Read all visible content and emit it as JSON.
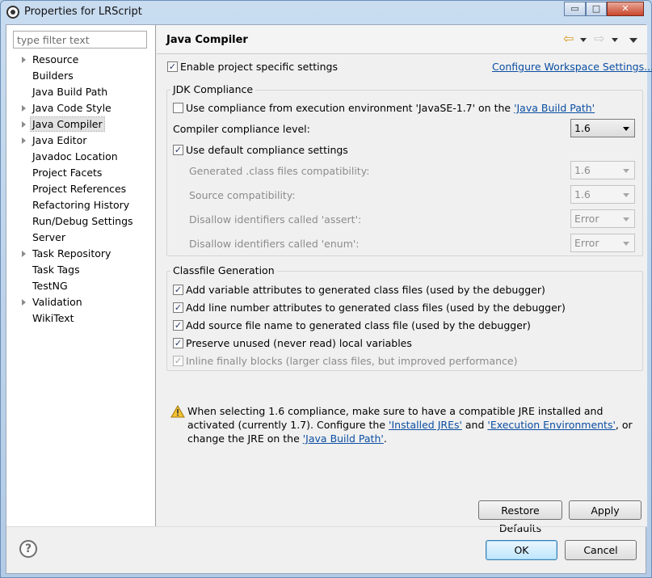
{
  "window": {
    "title": "Properties for LRScript",
    "minimize_glyph": "▭",
    "maximize_glyph": "□",
    "close_glyph": "✕"
  },
  "sidebar": {
    "filter_placeholder": "type filter text",
    "items": [
      {
        "label": "Resource",
        "expandable": true
      },
      {
        "label": "Builders",
        "expandable": false
      },
      {
        "label": "Java Build Path",
        "expandable": false
      },
      {
        "label": "Java Code Style",
        "expandable": true
      },
      {
        "label": "Java Compiler",
        "expandable": true,
        "selected": true
      },
      {
        "label": "Java Editor",
        "expandable": true
      },
      {
        "label": "Javadoc Location",
        "expandable": false
      },
      {
        "label": "Project Facets",
        "expandable": false
      },
      {
        "label": "Project References",
        "expandable": false
      },
      {
        "label": "Refactoring History",
        "expandable": false
      },
      {
        "label": "Run/Debug Settings",
        "expandable": false
      },
      {
        "label": "Server",
        "expandable": false
      },
      {
        "label": "Task Repository",
        "expandable": true
      },
      {
        "label": "Task Tags",
        "expandable": false
      },
      {
        "label": "TestNG",
        "expandable": false
      },
      {
        "label": "Validation",
        "expandable": true
      },
      {
        "label": "WikiText",
        "expandable": false
      }
    ]
  },
  "page": {
    "title": "Java Compiler",
    "back_icon": "⇦",
    "forward_icon": "⇨",
    "enable_specific": {
      "label": "Enable project specific settings",
      "checked": true
    },
    "configure_link": "Configure Workspace Settings...",
    "jdk": {
      "group_title": "JDK Compliance",
      "use_env_prefix": "Use compliance from execution environment 'JavaSE-1.7' on the ",
      "use_env_link": "'Java Build Path'",
      "use_env_checked": false,
      "level_label": "Compiler compliance level:",
      "level_value": "1.6",
      "use_default": {
        "label": "Use default compliance settings",
        "checked": true
      },
      "generated_label": "Generated .class files compatibility:",
      "generated_value": "1.6",
      "source_label": "Source compatibility:",
      "source_value": "1.6",
      "assert_label": "Disallow identifiers called 'assert':",
      "assert_value": "Error",
      "enum_label": "Disallow identifiers called 'enum':",
      "enum_value": "Error"
    },
    "classfile": {
      "group_title": "Classfile Generation",
      "options": [
        {
          "label": "Add variable attributes to generated class files (used by the debugger)",
          "checked": true,
          "enabled": true
        },
        {
          "label": "Add line number attributes to generated class files (used by the debugger)",
          "checked": true,
          "enabled": true
        },
        {
          "label": "Add source file name to generated class file (used by the debugger)",
          "checked": true,
          "enabled": true
        },
        {
          "label": "Preserve unused (never read) local variables",
          "checked": true,
          "enabled": true
        },
        {
          "label": "Inline finally blocks (larger class files, but improved performance)",
          "checked": true,
          "enabled": false
        }
      ]
    },
    "warning": {
      "part1": "When selecting 1.6 compliance, make sure to have a compatible JRE installed and activated (currently 1.7). Configure the ",
      "link1": "'Installed JREs'",
      "part2": " and ",
      "link2": "'Execution Environments'",
      "part3": ", or change the JRE on the ",
      "link3": "'Java Build Path'",
      "part4": "."
    },
    "restore_defaults": "Restore Defaults",
    "apply": "Apply"
  },
  "footer": {
    "help_glyph": "?",
    "ok": "OK",
    "cancel": "Cancel"
  },
  "colors": {
    "link": "#0b4ea2",
    "warning": "#e8b41a"
  }
}
